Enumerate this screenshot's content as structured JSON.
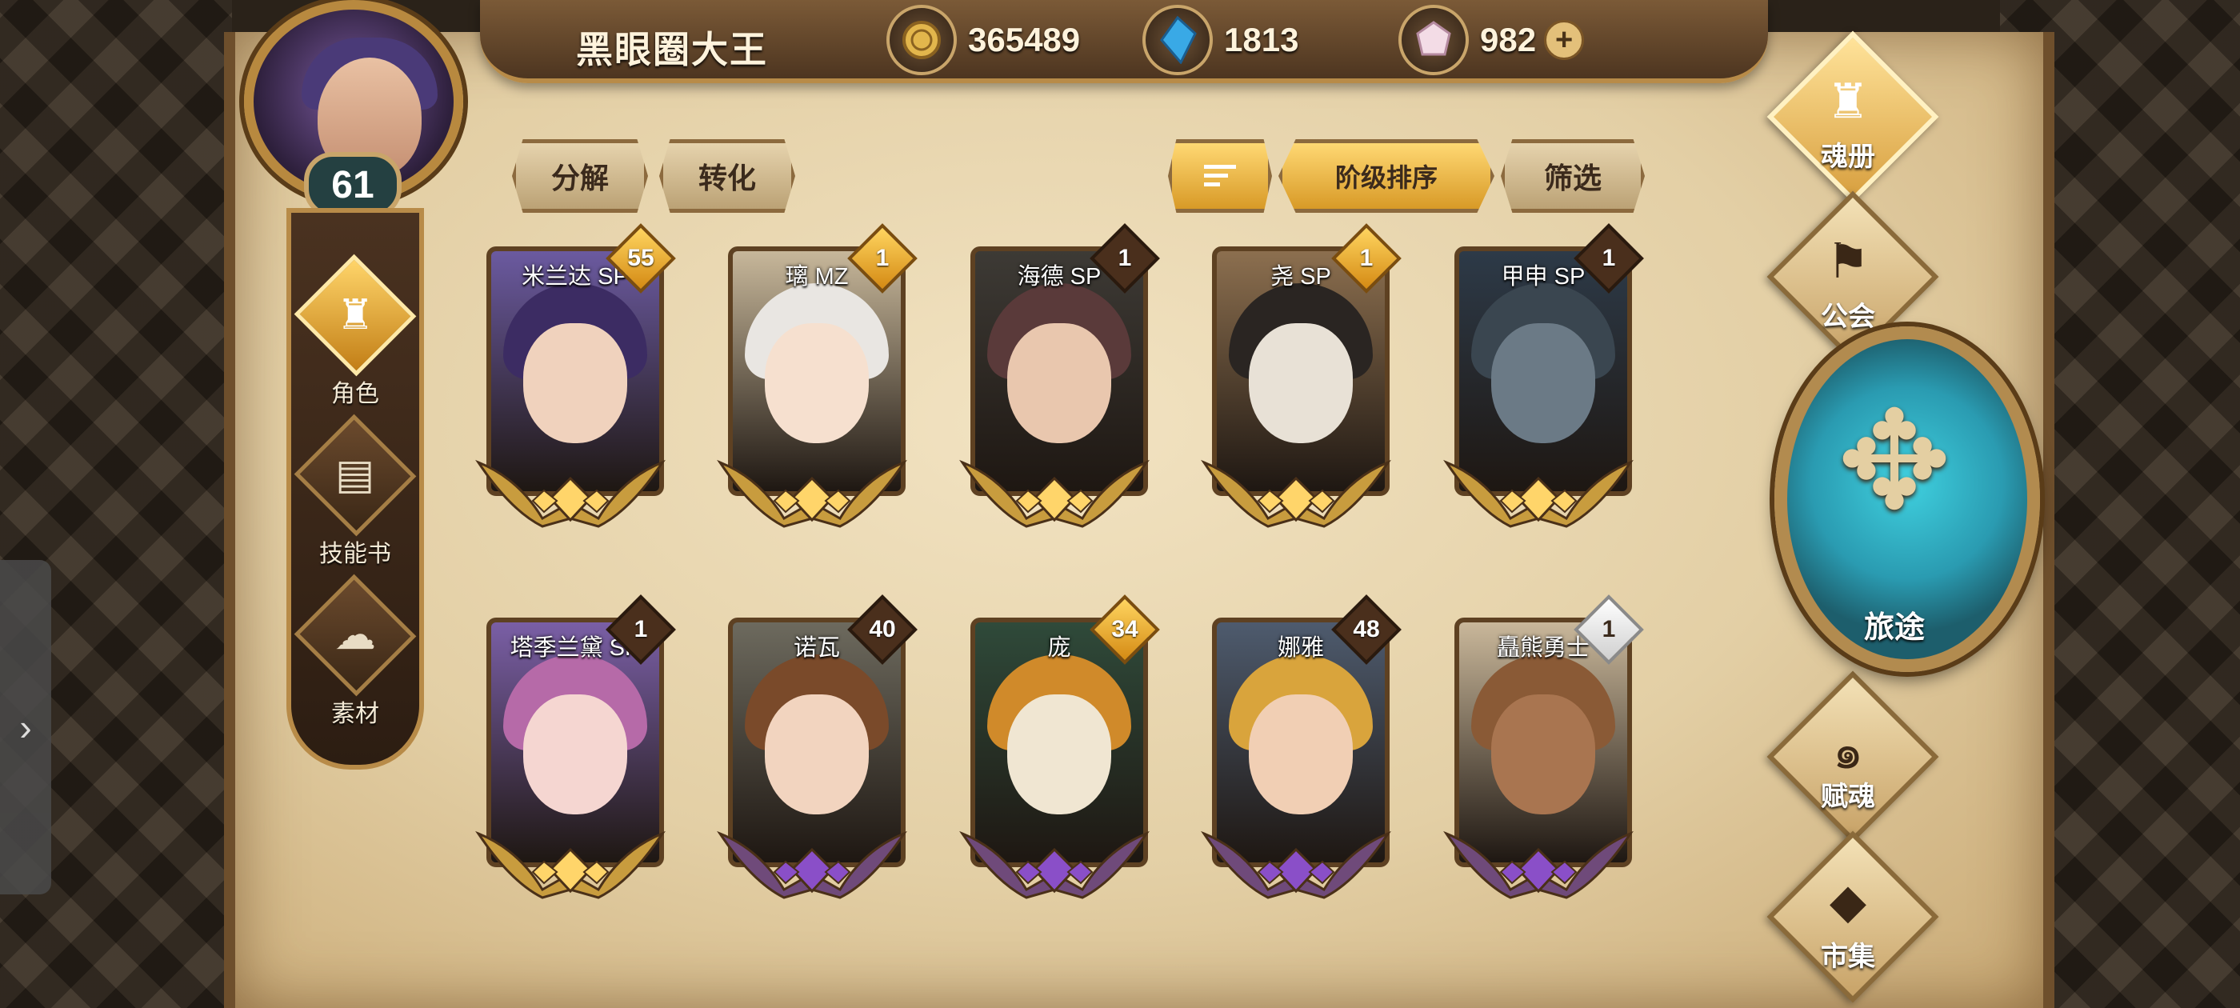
{
  "player": {
    "name": "黑眼圈大王",
    "level": "61"
  },
  "resources": {
    "gold": "365489",
    "gem": "1813",
    "crystal": "982",
    "add_icon": "plus-icon"
  },
  "left_nav": [
    {
      "label": "角色",
      "icon": "helmet-icon",
      "active": true
    },
    {
      "label": "技能书",
      "icon": "book-icon",
      "active": false
    },
    {
      "label": "素材",
      "icon": "spirit-icon",
      "active": false
    }
  ],
  "toolbar": {
    "decompose": "分解",
    "convert": "转化",
    "sort_icon": "sort-icon",
    "sort_rank": "阶级排序",
    "filter": "筛选"
  },
  "cards": [
    {
      "name": "米兰达 SP",
      "count": "55",
      "badge": "gold",
      "tier": "gold",
      "hair": "#3c2c63",
      "skin": "#f0d2bd",
      "bg": "#6b5aa0"
    },
    {
      "name": "璃 MZ",
      "count": "1",
      "badge": "gold",
      "tier": "gold",
      "hair": "#e9e6e2",
      "skin": "#f6e0cf",
      "bg": "#c7b79a"
    },
    {
      "name": "海德 SP",
      "count": "1",
      "badge": "dark",
      "tier": "gold",
      "hair": "#5a3a3a",
      "skin": "#e9c7ae",
      "bg": "#3d3a35"
    },
    {
      "name": "尧 SP",
      "count": "1",
      "badge": "gold",
      "tier": "gold",
      "hair": "#2a2522",
      "skin": "#e8e1d6",
      "bg": "#8c6f4f"
    },
    {
      "name": "甲申 SP",
      "count": "1",
      "badge": "dark",
      "tier": "gold",
      "hair": "#3a4650",
      "skin": "#6b7a86",
      "bg": "#2d3a48"
    },
    {
      "name": "塔季兰黛 SP",
      "count": "1",
      "badge": "dark",
      "tier": "gold",
      "hair": "#b66aa8",
      "skin": "#f5d6d1",
      "bg": "#7a5fa6"
    },
    {
      "name": "诺瓦",
      "count": "40",
      "badge": "dark",
      "tier": "purple",
      "hair": "#7a4a2a",
      "skin": "#f2d4bf",
      "bg": "#6d6a5e"
    },
    {
      "name": "庞",
      "count": "34",
      "badge": "gold",
      "tier": "purple",
      "hair": "#d08a2a",
      "skin": "#f0e6d2",
      "bg": "#2f4a3a"
    },
    {
      "name": "娜雅",
      "count": "48",
      "badge": "dark",
      "tier": "purple",
      "hair": "#d9a43c",
      "skin": "#f1cfb4",
      "bg": "#4e5b6e"
    },
    {
      "name": "矗熊勇士",
      "count": "1",
      "badge": "white",
      "tier": "purple",
      "hair": "#8a5a36",
      "skin": "#a97550",
      "bg": "#c9b79a"
    }
  ],
  "right_nav": {
    "soulbook": {
      "label": "魂册",
      "icon": "helmet-icon"
    },
    "guild": {
      "label": "公会",
      "icon": "banner-icon"
    },
    "journey": {
      "label": "旅途",
      "icon": "compass-icon"
    },
    "soul": {
      "label": "赋魂",
      "icon": "flame-icon"
    },
    "market": {
      "label": "市集",
      "icon": "gem-icon"
    }
  },
  "colors": {
    "gold_accent": "#ffd56a",
    "parchment": "#e9d6ae",
    "frame_brown": "#5e4122",
    "purple_tier": "#8a4fc8",
    "journey_teal": "#2a9bb1"
  }
}
